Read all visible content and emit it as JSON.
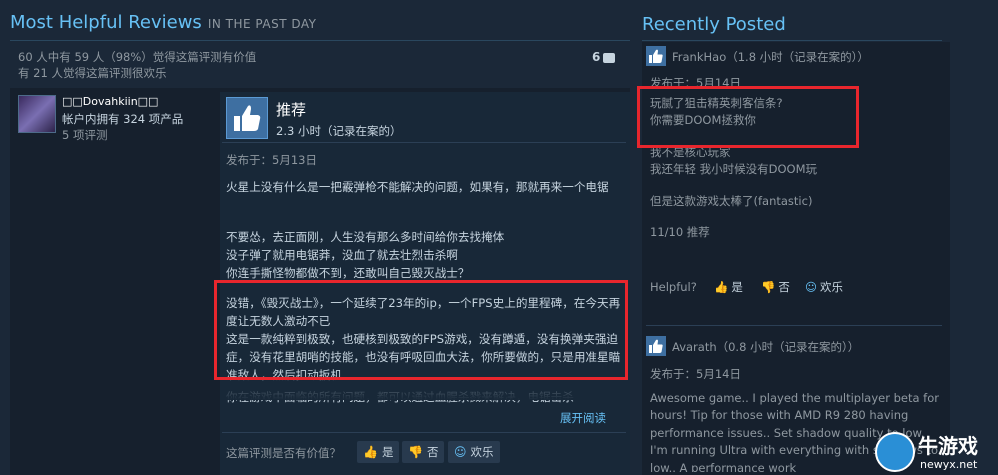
{
  "left": {
    "title": "Most Helpful Reviews",
    "subtitle": "IN THE PAST DAY",
    "helpful_line1": "60 人中有 59 人（98%）觉得这篇评测有价值",
    "helpful_line2": "有 21 人觉得这篇评测很欢乐",
    "comment_count": "6"
  },
  "author": {
    "name": "□□Dovahkiin□□",
    "products": "帐户内拥有 324 项产品",
    "reviews": "5 项评测"
  },
  "review": {
    "recommendation": "推荐",
    "hours": "2.3 小时（记录在案的）",
    "posted": "发布于：5月13日",
    "paragraphs": [
      "火星上没有什么是一把霰弹枪不能解决的问题，如果有，那就再来一个电锯",
      "不要怂，去正面刚，人生没有那么多时间给你去找掩体\n没子弹了就用电锯莽，没血了就去壮烈击杀啊\n你连手撕怪物都做不到，还敢叫自己毁灭战士？",
      "没错，《毁灭战士》，一个延续了23年的ip，一个FPS史上的里程碑，在今天再度让无数人激动不已\n这是一款纯粹到极致，也硬核到极致的FPS游戏，没有蹲遁，没有换弹夹强迫症，没有花里胡哨的技能，也没有呼吸回血大法，你所要做的，只是用准星瞄准敌人，然后扣动扳机",
      "你在游戏中面临的所有问题，都可以通过血腥杀戮来解决，电锯击杀"
    ],
    "read_more": "展开阅读",
    "vote_question": "这篇评测是否有价值？",
    "yes": "是",
    "no": "否",
    "funny": "欢乐"
  },
  "recent": {
    "title": "Recently Posted",
    "posts": [
      {
        "author": "FrankHao（1.8 小时（记录在案的））",
        "date": "发布于：5月14日",
        "paragraphs": [
          "玩腻了狙击精英刺客信条?\n你需要DOOM拯救你",
          "我不是核心玩家\n我还年轻 我小时候没有DOOM玩",
          "但是这款游戏太棒了(fantastic)",
          "11/10 推荐"
        ]
      },
      {
        "author": "Avarath（0.8 小时（记录在案的））",
        "date": "发布于：5月14日",
        "paragraphs": [
          "Awesome game.. I played the multiplayer beta for hours! Tip for those with AMD R9 280 having performance issues.. Set shadow quality to low. I'm running Ultra with everything with shadows to low.. A performance work"
        ]
      }
    ],
    "helpful_label": "Helpful?",
    "yes": "是",
    "no": "否",
    "funny": "欢乐"
  },
  "watermark": {
    "cn": "牛游戏",
    "url": "newyx.net"
  }
}
